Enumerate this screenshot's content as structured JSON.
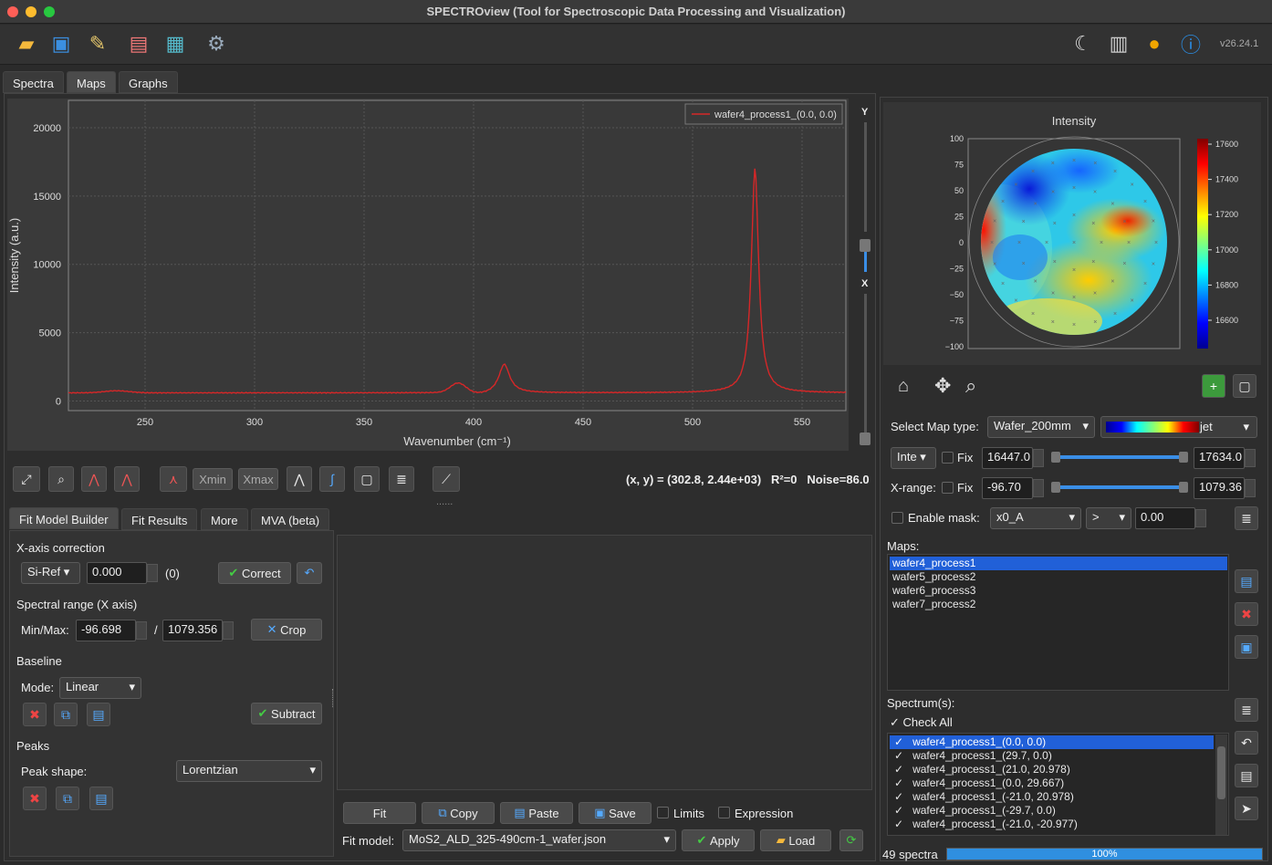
{
  "window": {
    "title": "SPECTROview (Tool for Spectroscopic Data Processing and Visualization)",
    "version": "v26.24.1"
  },
  "tabs": [
    "Spectra",
    "Maps",
    "Graphs"
  ],
  "spectrum_plot": {
    "legend": "wafer4_process1_(0.0, 0.0)",
    "ylabel": "Intensity (a.u.)",
    "xlabel": "Wavenumber (cm⁻¹)",
    "yticks": [
      "20000",
      "15000",
      "10000",
      "5000",
      "0"
    ],
    "xticks": [
      "250",
      "300",
      "350",
      "400",
      "450",
      "500",
      "550"
    ],
    "line_color": "#d62728"
  },
  "slider_labels": {
    "y": "Y",
    "x": "X"
  },
  "toolbar2": {
    "xmin": "Xmin",
    "xmax": "Xmax",
    "status": "(x, y) = (302.8, 2.44e+03)   R²=0   Noise=86.0",
    "dots": "......"
  },
  "fit_tabs": [
    "Fit Model Builder",
    "Fit Results",
    "More",
    "MVA (beta)"
  ],
  "fit": {
    "xaxis_title": "X-axis correction",
    "ref": "Si-Ref",
    "ref_value": "0.000",
    "ref_offset": "(0)",
    "correct": "Correct",
    "range_title": "Spectral range (X axis)",
    "minmax_label": "Min/Max:",
    "min": "-96.698",
    "slash": "/",
    "max": "1079.356",
    "crop": "Crop",
    "baseline_title": "Baseline",
    "mode_label": "Mode:",
    "mode": "Linear",
    "subtract": "Subtract",
    "peaks_title": "Peaks",
    "shape_label": "Peak shape:",
    "shape": "Lorentzian"
  },
  "fit_buttons": {
    "fit": "Fit",
    "copy": "Copy",
    "paste": "Paste",
    "save": "Save",
    "limits": "Limits",
    "expression": "Expression",
    "model_label": "Fit model:",
    "model": "MoS2_ALD_325-490cm-1_wafer.json",
    "apply": "Apply",
    "load": "Load"
  },
  "map": {
    "title": "Intensity",
    "yticks": [
      "100",
      "75",
      "50",
      "25",
      "0",
      "−25",
      "−50",
      "−75",
      "−100"
    ],
    "cbar_ticks": [
      "17600",
      "17400",
      "17200",
      "17000",
      "16800",
      "16600"
    ]
  },
  "map_controls": {
    "map_type_label": "Select Map type:",
    "map_type": "Wafer_200mm",
    "cmap": "jet",
    "inte": "Inte",
    "fix": "Fix",
    "vmin": "16447.0",
    "vmax": "17634.0",
    "xrange_label": "X-range:",
    "xmin": "-96.70",
    "xmax": "1079.36",
    "mask_label": "Enable mask:",
    "mask_param": "x0_A",
    "mask_op": ">",
    "mask_value": "0.00"
  },
  "maps": {
    "label": "Maps:",
    "items": [
      "wafer4_process1",
      "wafer5_process2",
      "wafer6_process3",
      "wafer7_process2"
    ]
  },
  "spectra": {
    "label": "Spectrum(s):",
    "check_all": "Check All",
    "items": [
      "wafer4_process1_(0.0, 0.0)",
      "wafer4_process1_(29.7, 0.0)",
      "wafer4_process1_(21.0, 20.978)",
      "wafer4_process1_(0.0, 29.667)",
      "wafer4_process1_(-21.0, 20.978)",
      "wafer4_process1_(-29.7, 0.0)",
      "wafer4_process1_(-21.0, -20.977)"
    ],
    "count": "49 spectra",
    "progress": "100%",
    "progress_value": 1.0
  }
}
